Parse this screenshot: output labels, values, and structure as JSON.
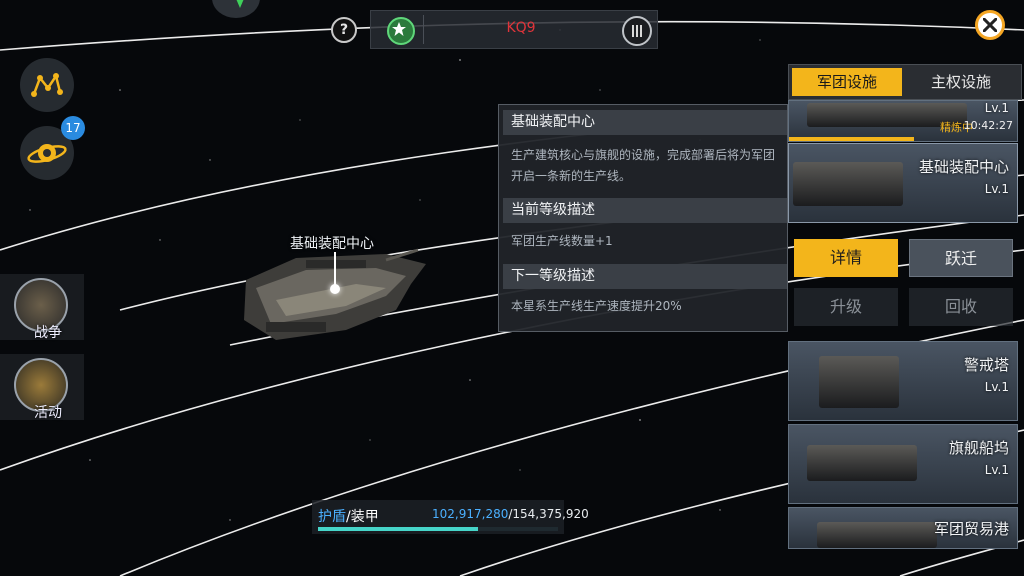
{
  "top_bar": {
    "help": "?",
    "coord": "KQ9"
  },
  "left_menu": {
    "galaxy_badge": "17",
    "war_label": "战争",
    "event_label": "活动"
  },
  "ship": {
    "label": "基础装配中心"
  },
  "info_panel": {
    "title": "基础装配中心",
    "description": "生产建筑核心与旗舰的设施，完成部署后将为军团开启一条新的生产线。",
    "current_header": "当前等级描述",
    "current_text": "军团生产线数量+1",
    "next_header": "下一等级描述",
    "next_text": "本星系生产线生产速度提升20%"
  },
  "right_panel": {
    "tabs": [
      "军团设施",
      "主权设施"
    ],
    "active_tab": 0,
    "cards": [
      {
        "name": "",
        "level": "Lv.1",
        "status": "精炼中",
        "time": "10:42:27",
        "progress": 0.55
      },
      {
        "name": "基础装配中心",
        "level": "Lv.1"
      },
      {
        "name": "警戒塔",
        "level": "Lv.1"
      },
      {
        "name": "旗舰船坞",
        "level": "Lv.1"
      },
      {
        "name": "军团贸易港",
        "level": ""
      }
    ],
    "buttons": {
      "details": "详情",
      "jump": "跃迁",
      "upgrade": "升级",
      "recycle": "回收"
    }
  },
  "shield": {
    "label_shield": "护盾",
    "label_armor": "/装甲",
    "current": "102,917,280",
    "total": "/154,375,920",
    "fill": 0.667
  },
  "colors": {
    "accent": "#f3b51b",
    "shield": "#46d5c9",
    "coord": "#e0343a"
  }
}
